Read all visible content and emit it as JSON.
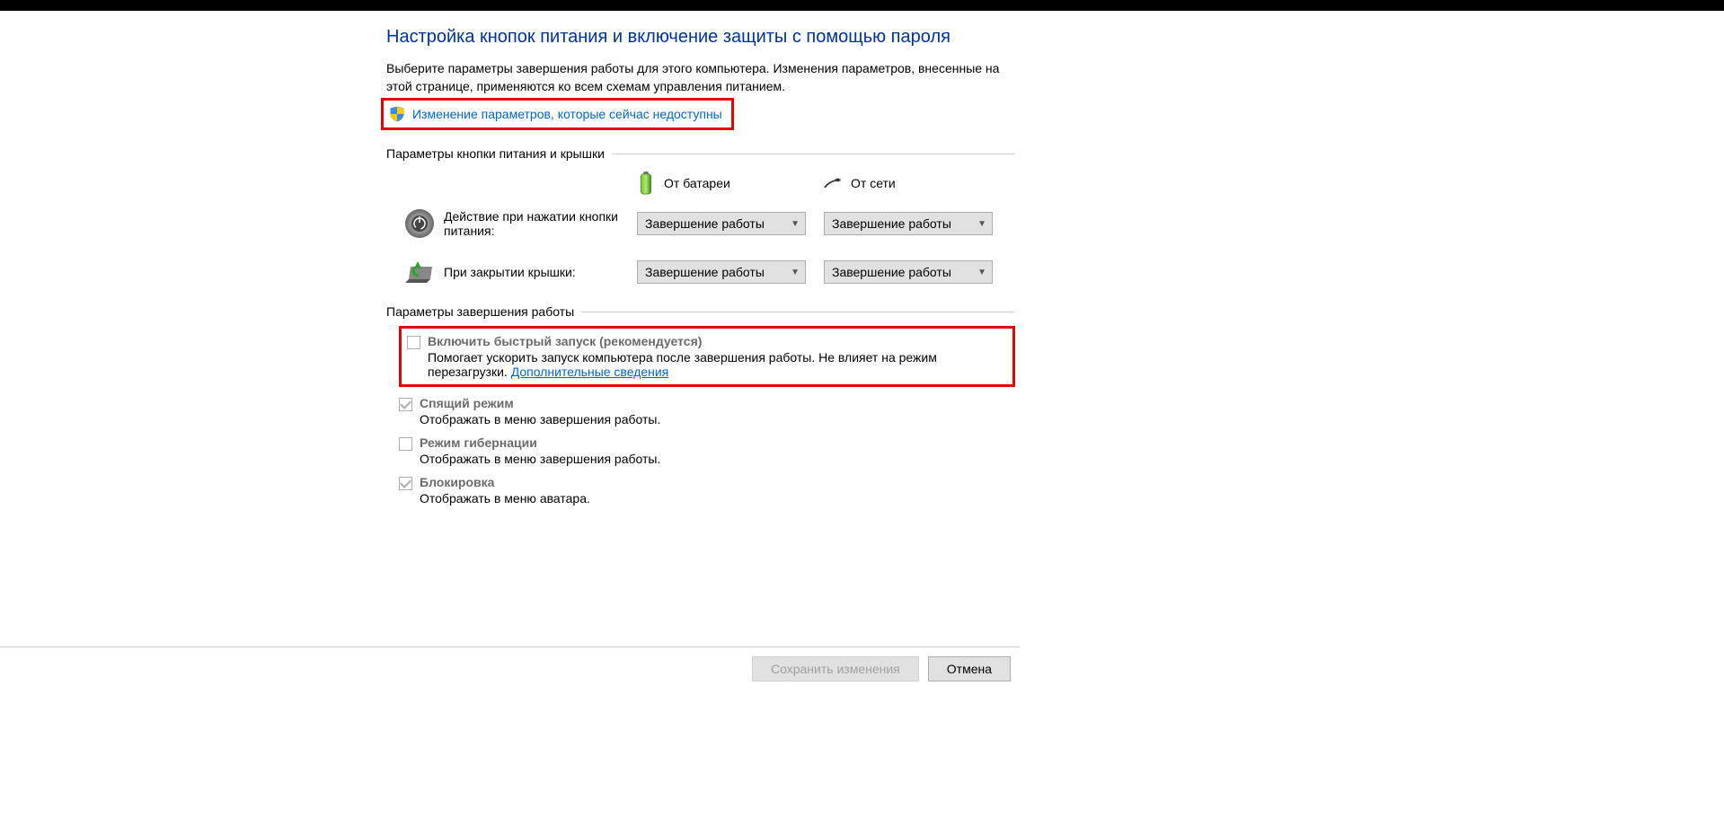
{
  "title": "Настройка кнопок питания и включение защиты с помощью пароля",
  "intro": "Выберите параметры завершения работы для этого компьютера. Изменения параметров, внесенные на этой странице, применяются ко всем схемам управления питанием.",
  "uac_link": "Изменение параметров, которые сейчас недоступны",
  "section1_title": "Параметры кнопки питания и крышки",
  "col_battery": "От батареи",
  "col_plugged": "От сети",
  "row_power_btn": "Действие при нажатии кнопки питания:",
  "row_lid": "При закрытии крышки:",
  "dd_value": "Завершение работы",
  "section2_title": "Параметры завершения работы",
  "shutdown_items": [
    {
      "checked": false,
      "title": "Включить быстрый запуск (рекомендуется)",
      "desc_pre": "Помогает ускорить запуск компьютера после завершения работы. Не влияет на режим перезагрузки. ",
      "link": "Дополнительные сведения",
      "highlighted": true
    },
    {
      "checked": true,
      "title": "Спящий режим",
      "desc_pre": "Отображать в меню завершения работы.",
      "link": "",
      "highlighted": false
    },
    {
      "checked": false,
      "title": "Режим гибернации",
      "desc_pre": "Отображать в меню завершения работы.",
      "link": "",
      "highlighted": false
    },
    {
      "checked": true,
      "title": "Блокировка",
      "desc_pre": "Отображать в меню аватара.",
      "link": "",
      "highlighted": false
    }
  ],
  "btn_save": "Сохранить изменения",
  "btn_cancel": "Отмена"
}
